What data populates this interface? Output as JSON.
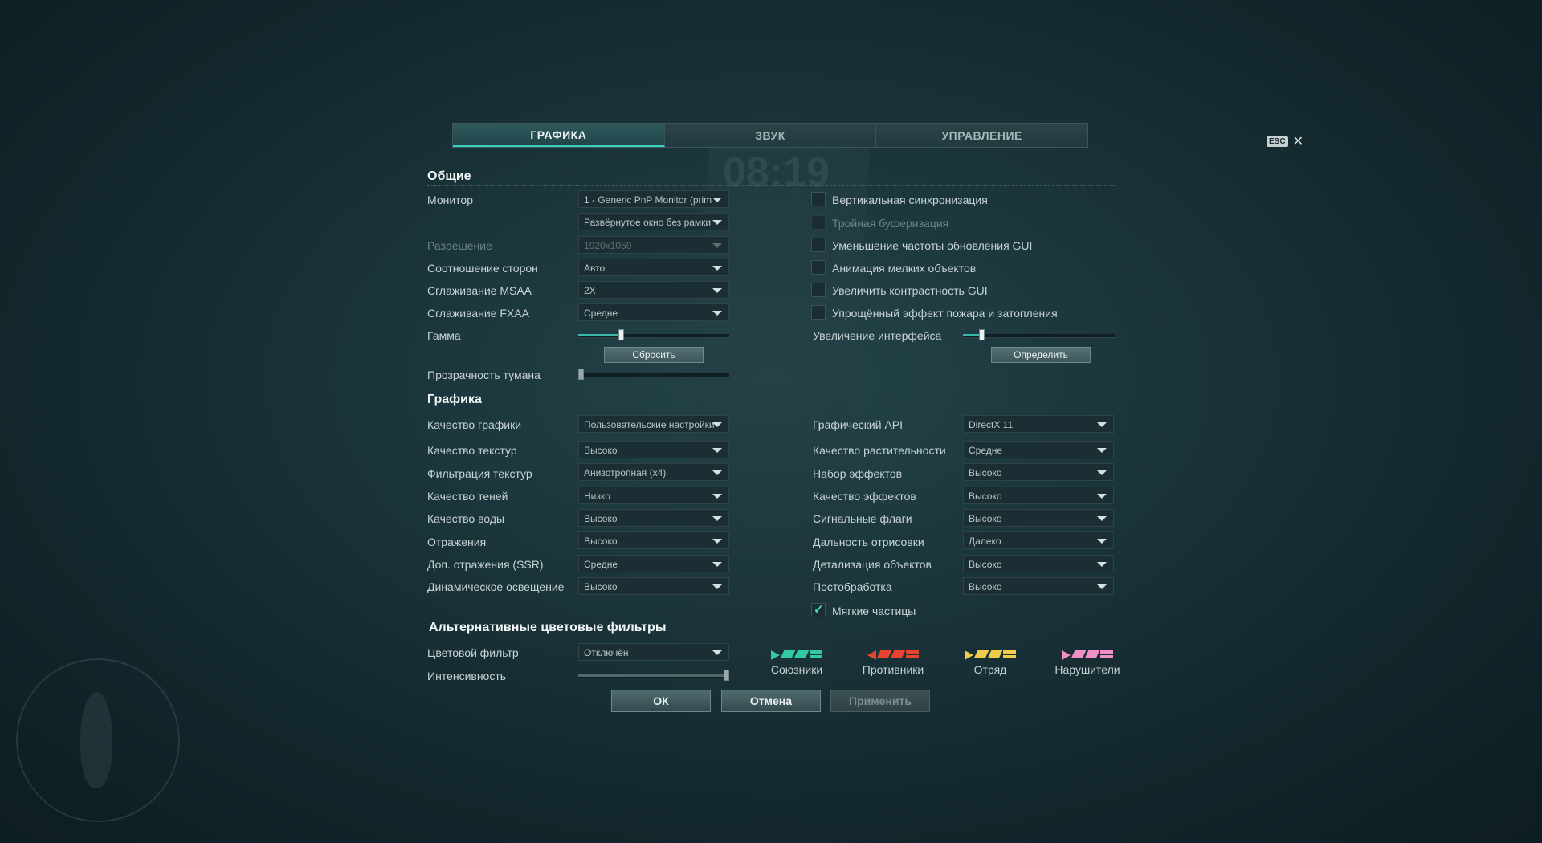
{
  "tabs": [
    {
      "label": "ГРАФИКА",
      "active": true
    },
    {
      "label": "ЗВУК",
      "active": false
    },
    {
      "label": "УПРАВЛЕНИЕ",
      "active": false
    }
  ],
  "close": {
    "esc_label": "ESC",
    "close_symbol": "✕"
  },
  "background": {
    "timer": "08:19"
  },
  "general": {
    "title": "Общие",
    "monitor": {
      "label": "Монитор",
      "value": "1 - Generic PnP Monitor (prim"
    },
    "window_mode": {
      "value": "Развёрнутое окно без рамки"
    },
    "resolution": {
      "label": "Разрешение",
      "value": "1920x1050"
    },
    "aspect": {
      "label": "Соотношение сторон",
      "value": "Авто"
    },
    "msaa": {
      "label": "Сглаживание MSAA",
      "value": "2X"
    },
    "fxaa": {
      "label": "Сглаживание FXAA",
      "value": "Средне"
    },
    "gamma": {
      "label": "Гамма",
      "level": 0.28,
      "reset_label": "Сбросить"
    },
    "fog": {
      "label": "Прозрачность тумана",
      "level": 0.0
    },
    "checkboxes": [
      {
        "label": "Вертикальная синхронизация",
        "checked": false,
        "disabled": false
      },
      {
        "label": "Тройная буферизация",
        "checked": false,
        "disabled": true
      },
      {
        "label": "Уменьшение частоты обновления GUI",
        "checked": false,
        "disabled": false
      },
      {
        "label": "Анимация мелких объектов",
        "checked": false,
        "disabled": false
      },
      {
        "label": "Увеличить контрастность GUI",
        "checked": false,
        "disabled": false
      },
      {
        "label": "Упрощённый эффект пожара и затопления",
        "checked": false,
        "disabled": false
      }
    ],
    "ui_scale": {
      "label": "Увеличение интерфейса",
      "level": 0.12,
      "detect_label": "Определить"
    }
  },
  "graphics": {
    "title": "Графика",
    "left": [
      {
        "label": "Качество графики",
        "value": "Пользовательские настройки"
      },
      {
        "label": "Качество текстур",
        "value": "Высоко"
      },
      {
        "label": "Фильтрация текстур",
        "value": "Анизотропная (x4)"
      },
      {
        "label": "Качество теней",
        "value": "Низко"
      },
      {
        "label": "Качество воды",
        "value": "Высоко"
      },
      {
        "label": "Отражения",
        "value": "Высоко"
      },
      {
        "label": "Доп. отражения (SSR)",
        "value": "Средне"
      },
      {
        "label": "Динамическое освещение",
        "value": "Высоко"
      }
    ],
    "right": [
      {
        "label": "Графический API",
        "value": "DirectX 11"
      },
      {
        "label": "Качество растительности",
        "value": "Средне"
      },
      {
        "label": "Набор эффектов",
        "value": "Высоко"
      },
      {
        "label": "Качество эффектов",
        "value": "Высоко"
      },
      {
        "label": "Сигнальные флаги",
        "value": "Высоко"
      },
      {
        "label": "Дальность отрисовки",
        "value": "Далеко"
      },
      {
        "label": "Детализация объектов",
        "value": "Высоко"
      },
      {
        "label": "Постобработка",
        "value": "Высоко"
      }
    ],
    "soft_particles": {
      "label": "Мягкие частицы",
      "checked": true
    }
  },
  "filters": {
    "title": "Альтернативные цветовые фильтры",
    "color_filter": {
      "label": "Цветовой фильтр",
      "value": "Отключён"
    },
    "intensity": {
      "label": "Интенсивность",
      "level": 1.0
    },
    "legends": [
      {
        "label": "Союзники",
        "color": "#33c9a4"
      },
      {
        "label": "Противники",
        "color": "#e8442f"
      },
      {
        "label": "Отряд",
        "color": "#f0cc4a"
      },
      {
        "label": "Нарушители",
        "color": "#f08fc8"
      }
    ]
  },
  "footer": {
    "ok": "ОК",
    "cancel": "Отмена",
    "apply": "Применить"
  }
}
